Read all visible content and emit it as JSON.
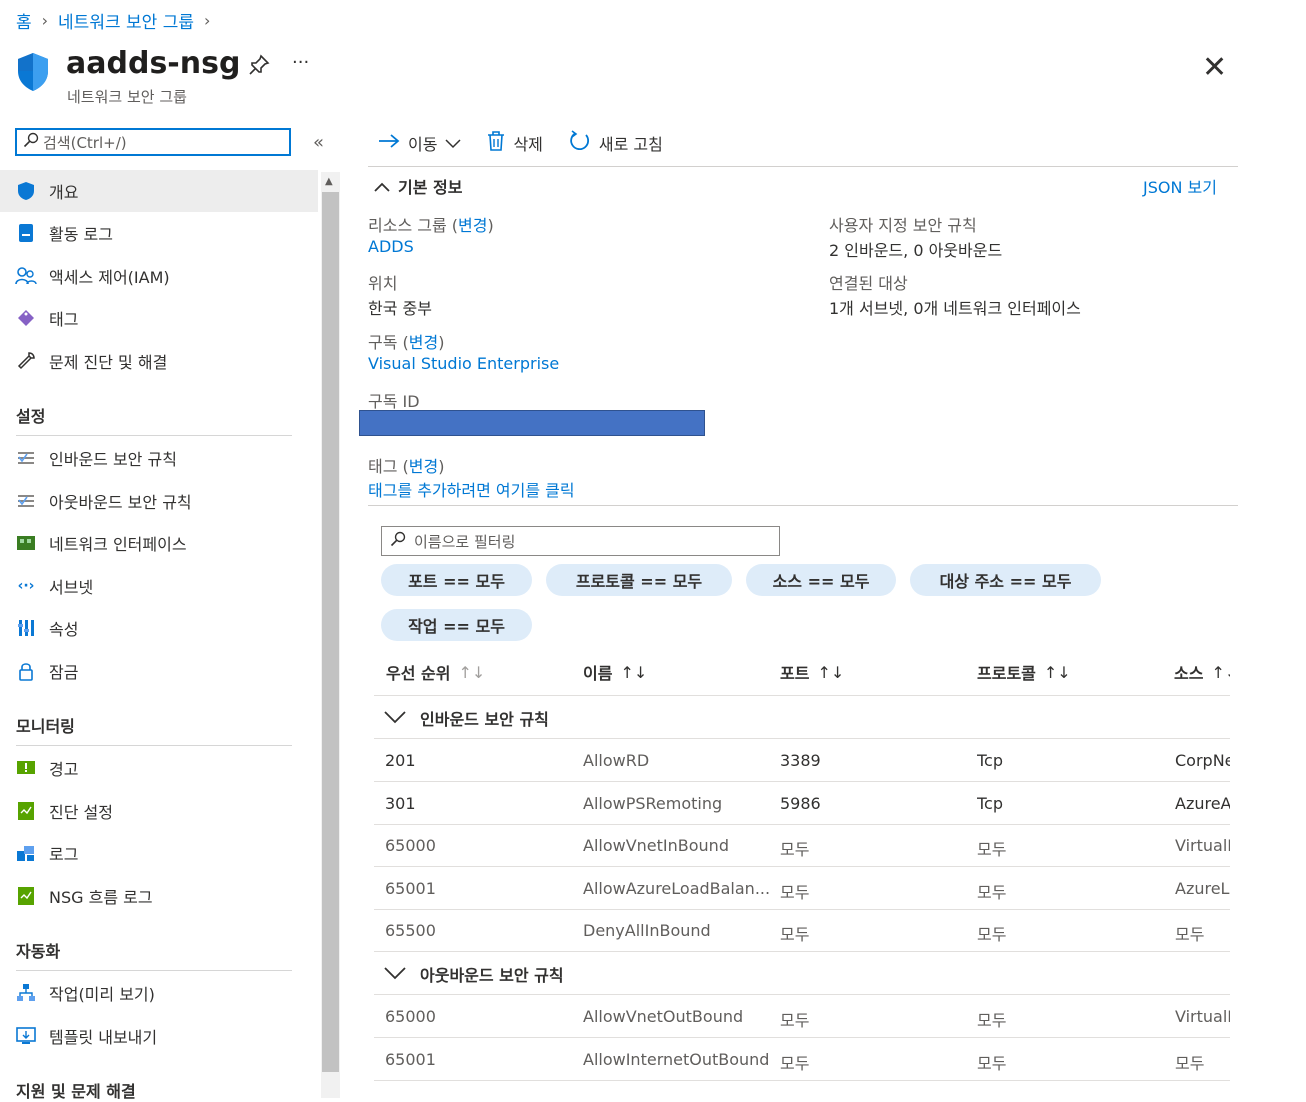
{
  "breadcrumb": {
    "home": "홈",
    "parent": "네트워크 보안 그룹"
  },
  "header": {
    "title": "aadds-nsg",
    "subtitle": "네트워크 보안 그룹"
  },
  "sidebar": {
    "search_placeholder": "검색(Ctrl+/)",
    "items": [
      {
        "label": "개요",
        "icon": "shield-icon"
      },
      {
        "label": "활동 로그",
        "icon": "activity-log-icon"
      },
      {
        "label": "액세스 제어(IAM)",
        "icon": "people-icon"
      },
      {
        "label": "태그",
        "icon": "tag-icon"
      },
      {
        "label": "문제 진단 및 해결",
        "icon": "wrench-icon"
      }
    ],
    "settings_header": "설정",
    "settings_items": [
      {
        "label": "인바운드 보안 규칙",
        "icon": "inbound-rules-icon"
      },
      {
        "label": "아웃바운드 보안 규칙",
        "icon": "outbound-rules-icon"
      },
      {
        "label": "네트워크 인터페이스",
        "icon": "nic-icon"
      },
      {
        "label": "서브넷",
        "icon": "subnet-icon"
      },
      {
        "label": "속성",
        "icon": "properties-icon"
      },
      {
        "label": "잠금",
        "icon": "lock-icon"
      }
    ],
    "monitoring_header": "모니터링",
    "monitoring_items": [
      {
        "label": "경고",
        "icon": "alert-icon"
      },
      {
        "label": "진단 설정",
        "icon": "diagnostic-settings-icon"
      },
      {
        "label": "로그",
        "icon": "logs-icon"
      },
      {
        "label": "NSG 흐름 로그",
        "icon": "flow-log-icon"
      }
    ],
    "automation_header": "자동화",
    "automation_items": [
      {
        "label": "작업(미리 보기)",
        "icon": "tasks-icon"
      },
      {
        "label": "템플릿 내보내기",
        "icon": "export-template-icon"
      }
    ],
    "support_header": "지원 및 문제 해결"
  },
  "toolbar": {
    "move": "이동",
    "delete": "삭제",
    "refresh": "새로 고침"
  },
  "essentials": {
    "header": "기본 정보",
    "json_view": "JSON 보기",
    "resource_group_label": "리소스 그룹",
    "change": "변경",
    "resource_group": "ADDS",
    "location_label": "위치",
    "location": "한국 중부",
    "subscription_label": "구독",
    "subscription": "Visual Studio Enterprise",
    "subscription_id_label": "구독 ID",
    "tags_label": "태그",
    "tags_link": "태그를 추가하려면 여기를 클릭",
    "custom_rules_label": "사용자 지정 보안 규칙",
    "custom_rules": "2 인바운드, 0 아웃바운드",
    "associated_label": "연결된 대상",
    "associated": "1개 서브넷, 0개 네트워크 인터페이스"
  },
  "filter": {
    "placeholder": "이름으로 필터링",
    "pills": [
      "포트 == 모두",
      "프로토콜 == 모두",
      "소스 == 모두",
      "대상 주소 == 모두",
      "작업 == 모두"
    ]
  },
  "table": {
    "columns": [
      "우선 순위",
      "이름",
      "포트",
      "프로토콜",
      "소스"
    ],
    "inbound_group": "인바운드 보안 규칙",
    "outbound_group": "아웃바운드 보안 규칙",
    "inbound": [
      {
        "priority": "201",
        "name": "AllowRD",
        "port": "3389",
        "protocol": "Tcp",
        "source": "CorpNe"
      },
      {
        "priority": "301",
        "name": "AllowPSRemoting",
        "port": "5986",
        "protocol": "Tcp",
        "source": "AzureA"
      },
      {
        "priority": "65000",
        "name": "AllowVnetInBound",
        "port": "모두",
        "protocol": "모두",
        "source": "VirtualN"
      },
      {
        "priority": "65001",
        "name": "AllowAzureLoadBalan...",
        "port": "모두",
        "protocol": "모두",
        "source": "AzureLo"
      },
      {
        "priority": "65500",
        "name": "DenyAllInBound",
        "port": "모두",
        "protocol": "모두",
        "source": "모두"
      }
    ],
    "outbound": [
      {
        "priority": "65000",
        "name": "AllowVnetOutBound",
        "port": "모두",
        "protocol": "모두",
        "source": "VirtualN"
      },
      {
        "priority": "65001",
        "name": "AllowInternetOutBound",
        "port": "모두",
        "protocol": "모두",
        "source": "모두"
      }
    ]
  }
}
